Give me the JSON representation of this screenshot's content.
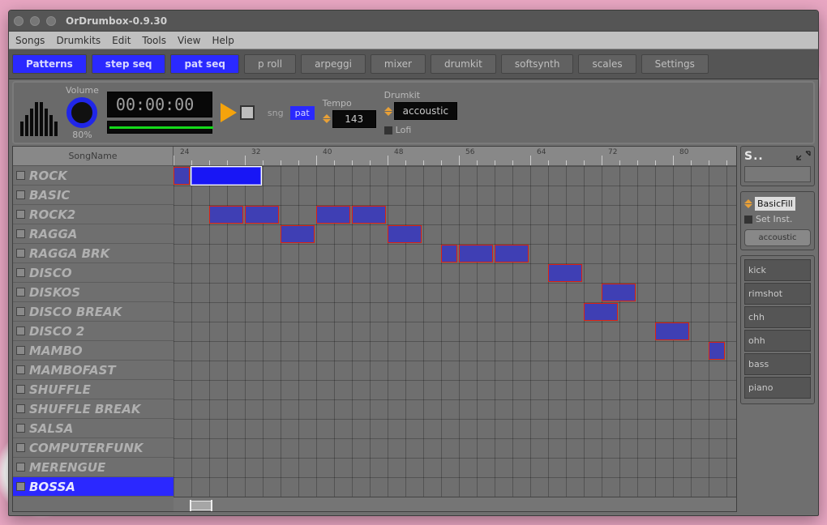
{
  "window": {
    "title": "OrDrumbox-0.9.30"
  },
  "menu": {
    "items": [
      "Songs",
      "Drumkits",
      "Edit",
      "Tools",
      "View",
      "Help"
    ]
  },
  "tabs": [
    {
      "label": "Patterns",
      "sel": true
    },
    {
      "label": "step seq",
      "sel": true
    },
    {
      "label": "pat seq",
      "sel": true
    },
    {
      "label": "p roll",
      "sel": false
    },
    {
      "label": "arpeggi",
      "sel": false
    },
    {
      "label": "mixer",
      "sel": false
    },
    {
      "label": "drumkit",
      "sel": false
    },
    {
      "label": "softsynth",
      "sel": false
    },
    {
      "label": "scales",
      "sel": false
    },
    {
      "label": "Settings",
      "sel": false
    }
  ],
  "transport": {
    "volume_label": "Volume",
    "volume_value": "80%",
    "timecode": "00:00:00",
    "mode_sng": "sng",
    "mode_pat": "pat",
    "tempo_label": "Tempo",
    "tempo_value": "143",
    "drumkit_label": "Drumkit",
    "drumkit_value": "accoustic",
    "lofi_label": "Lofi"
  },
  "tracks_header": "SongName",
  "ruler_positions": [
    24,
    32,
    40,
    48,
    56,
    64,
    72,
    80
  ],
  "tracks": [
    {
      "name": "ROCK",
      "selected": false
    },
    {
      "name": "BASIC",
      "selected": false
    },
    {
      "name": "ROCK2",
      "selected": false
    },
    {
      "name": "RAGGA",
      "selected": false
    },
    {
      "name": "RAGGA BRK",
      "selected": false
    },
    {
      "name": "DISCO",
      "selected": false
    },
    {
      "name": "DISKOS",
      "selected": false
    },
    {
      "name": "DISCO BREAK",
      "selected": false
    },
    {
      "name": "DISCO 2",
      "selected": false
    },
    {
      "name": "MAMBO",
      "selected": false
    },
    {
      "name": "MAMBOFAST",
      "selected": false
    },
    {
      "name": "SHUFFLE",
      "selected": false
    },
    {
      "name": "SHUFFLE BREAK",
      "selected": false
    },
    {
      "name": "SALSA",
      "selected": false
    },
    {
      "name": "COMPUTERFUNK",
      "selected": false
    },
    {
      "name": "MERENGUE",
      "selected": false
    },
    {
      "name": "BOSSA",
      "selected": true
    }
  ],
  "blocks": [
    {
      "row": 0,
      "col": 0,
      "span": 1,
      "sel": false
    },
    {
      "row": 0,
      "col": 1,
      "span": 4,
      "sel": true
    },
    {
      "row": 2,
      "col": 2,
      "span": 2,
      "sel": false
    },
    {
      "row": 2,
      "col": 4,
      "span": 2,
      "sel": false
    },
    {
      "row": 2,
      "col": 8,
      "span": 2,
      "sel": false
    },
    {
      "row": 2,
      "col": 10,
      "span": 2,
      "sel": false
    },
    {
      "row": 3,
      "col": 6,
      "span": 2,
      "sel": false
    },
    {
      "row": 3,
      "col": 12,
      "span": 2,
      "sel": false
    },
    {
      "row": 4,
      "col": 15,
      "span": 1,
      "sel": false
    },
    {
      "row": 4,
      "col": 16,
      "span": 2,
      "sel": false
    },
    {
      "row": 4,
      "col": 18,
      "span": 2,
      "sel": false
    },
    {
      "row": 5,
      "col": 21,
      "span": 2,
      "sel": false
    },
    {
      "row": 6,
      "col": 24,
      "span": 2,
      "sel": false
    },
    {
      "row": 7,
      "col": 23,
      "span": 2,
      "sel": false
    },
    {
      "row": 8,
      "col": 27,
      "span": 2,
      "sel": false
    },
    {
      "row": 9,
      "col": 30,
      "span": 1,
      "sel": false
    }
  ],
  "side": {
    "title": "S..",
    "basicfill": "BasicFill",
    "setinst": "Set Inst.",
    "kit_button": "accoustic",
    "insts": [
      "kick",
      "rimshot",
      "chh",
      "ohh",
      "bass",
      "piano"
    ]
  }
}
